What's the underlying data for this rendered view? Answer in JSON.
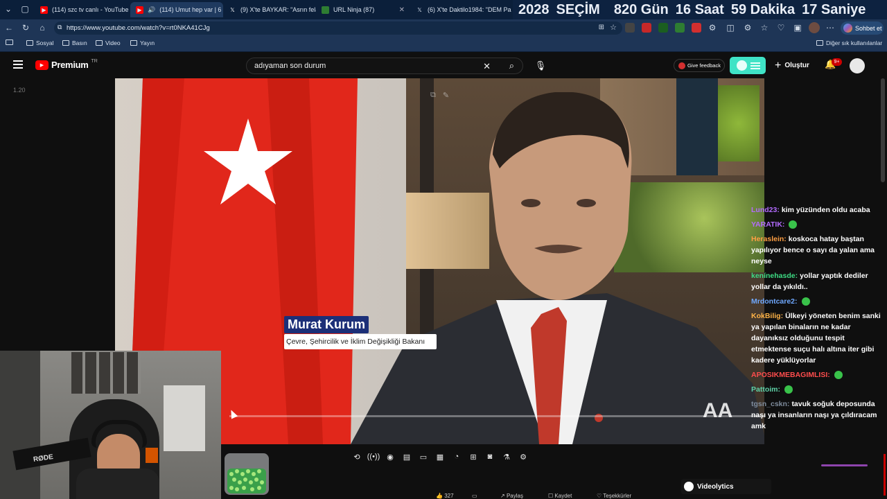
{
  "browser": {
    "tabs": [
      {
        "title": "(114) szc tv canlı - YouTube",
        "icon": "youtube-icon"
      },
      {
        "title": "(114) Umut hep var | 6",
        "icon": "youtube-icon",
        "active": true
      },
      {
        "title": "(9) X'te BAYKAR: \"Asrın felak",
        "icon": "x-icon"
      },
      {
        "title": "URL Ninja (87)",
        "icon": "ninja-icon"
      },
      {
        "title": "(6) X'te Daktilo1984: \"DEM Pa",
        "icon": "x-icon"
      }
    ],
    "countdown": {
      "year": "2028",
      "label": "SEÇİM",
      "days": "820 Gün",
      "hours": "16 Saat",
      "minutes": "59 Dakika",
      "seconds": "17 Saniye"
    },
    "url": "https://www.youtube.com/watch?v=rt0NKA41CJg",
    "chat_button": "Sohbet et",
    "bookmarks": [
      "Sosyal",
      "Basın",
      "Video",
      "Yayın"
    ],
    "other_bookmarks": "Diğer sık kullanılanlar"
  },
  "youtube": {
    "logo": "Premium",
    "logo_region": "TR",
    "search_value": "adıyaman son durum",
    "feedback": "Give feedback",
    "create": "Oluştur",
    "notification_count": "9+",
    "speed_label": "1.20"
  },
  "video": {
    "name": "Murat Kurum",
    "title": "Çevre, Şehircilik ve İklim Değişikliği Bakanı",
    "watermark": "AA"
  },
  "chat": [
    {
      "user": "Lund23:",
      "text": "kim yüzünden oldu acaba",
      "color": "#b36bff"
    },
    {
      "user": "YARATIK:",
      "text": "",
      "color": "#b36bff",
      "emoji": true
    },
    {
      "user": "Heraslein:",
      "text": "koskoca hatay baştan yapılıyor bence o sayı da yalan ama neyse",
      "color": "#ff9f43"
    },
    {
      "user": "kenínehasde:",
      "text": "yollar yaptık dediler yollar da yıkıldı..",
      "color": "#3ddc84"
    },
    {
      "user": "Mrdontcare2:",
      "text": "",
      "color": "#6fa8ff",
      "emoji": true
    },
    {
      "user": "KokBilig:",
      "text": "Ülkeyi yöneten benim sanki ya yapılan binaların ne kadar dayanıksız olduğunu tespit etmektense suçu halı altına iter gibi kadere yüklüyorlar",
      "color": "#ffb347"
    },
    {
      "user": "APOSIKMEBAGIMLISI:",
      "text": "",
      "color": "#ff4d4d",
      "emoji": true
    },
    {
      "user": "Pattoim:",
      "text": "",
      "color": "#5fd3a8",
      "emoji": true
    },
    {
      "user": "tgsn_cskn:",
      "text": "tavuk soğuk deposunda naşı ya insanların naşı ya çıldıracam amk",
      "color": "#7f8c9d"
    }
  ],
  "bottom": {
    "videolytics": "Videolytics",
    "actions": [
      "327",
      "",
      "Paylaş",
      "Kaydet",
      "Teşekkürler"
    ]
  },
  "colors": {
    "youtube_red": "#ff0000",
    "tab_bg": "#0b1f3a",
    "accent_pill": "#3fe3c6"
  }
}
